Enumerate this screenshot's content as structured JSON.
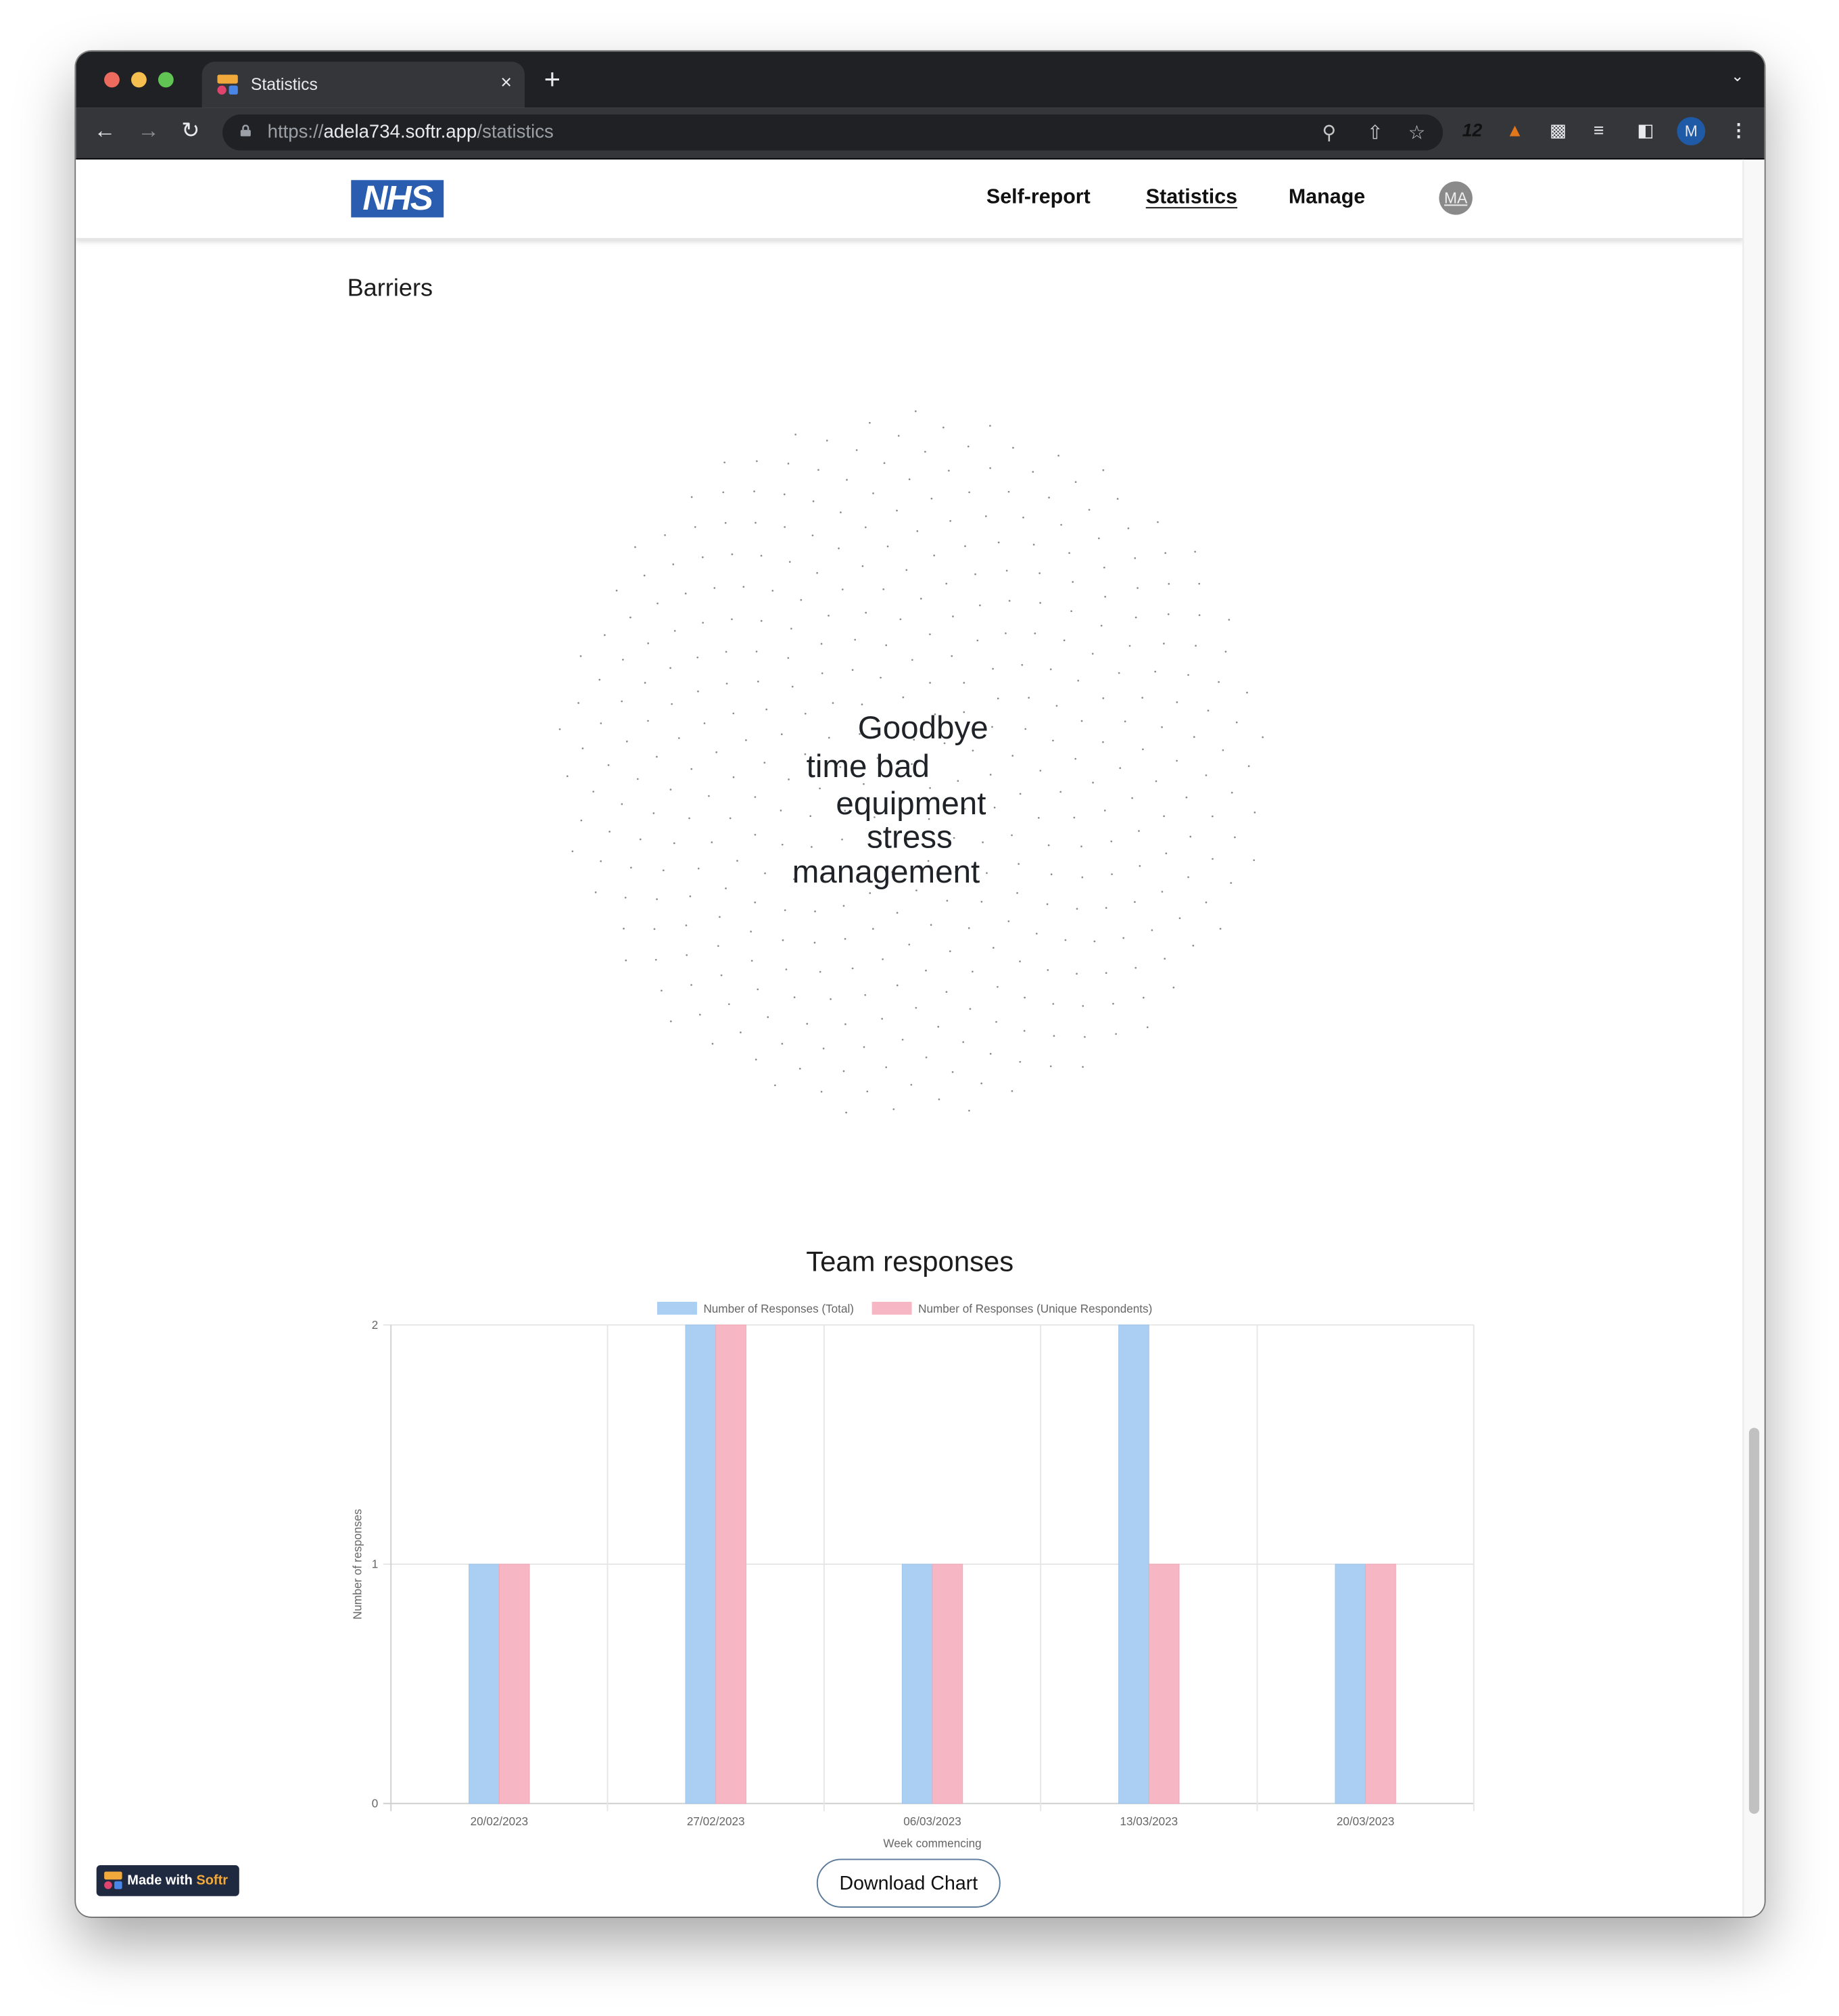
{
  "browser": {
    "tab_title": "Statistics",
    "tab_close": "×",
    "new_tab": "+",
    "url_scheme": "https://",
    "url_host": "adela734.softr.app",
    "url_path": "/statistics",
    "profile_initial": "M",
    "extensions": [
      "12ft",
      "metamask-fox",
      "extensions-puzzle",
      "media-queue",
      "side-panel"
    ]
  },
  "header": {
    "logo_text": "NHS",
    "nav": [
      {
        "label": "Self-report",
        "active": false
      },
      {
        "label": "Statistics",
        "active": true
      },
      {
        "label": "Manage",
        "active": false
      }
    ],
    "avatar_initials": "MA"
  },
  "barriers": {
    "title": "Barriers",
    "words": [
      "Goodbye",
      "time bad",
      "equipment",
      "stress",
      "management"
    ]
  },
  "chart_data": {
    "type": "bar",
    "title": "Team responses",
    "categories": [
      "20/02/2023",
      "27/02/2023",
      "06/03/2023",
      "13/03/2023",
      "20/03/2023"
    ],
    "series": [
      {
        "name": "Number of Responses (Total)",
        "color": "#abcff2",
        "values": [
          1,
          2,
          1,
          2,
          1
        ]
      },
      {
        "name": "Number of Responses (Unique Respondents)",
        "color": "#f7b6c3",
        "values": [
          1,
          2,
          1,
          1,
          1
        ]
      }
    ],
    "xlabel": "Week commencing",
    "ylabel": "Number of responses",
    "ylim": [
      0,
      2
    ],
    "yticks": [
      0,
      1,
      2
    ],
    "grid": true,
    "legend": "top-center"
  },
  "actions": {
    "download_label": "Download Chart"
  },
  "badge": {
    "prefix": "Made with ",
    "brand": "Softr"
  }
}
